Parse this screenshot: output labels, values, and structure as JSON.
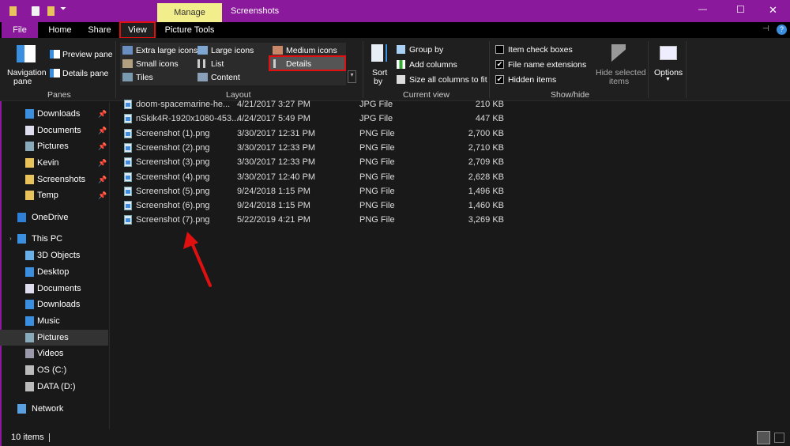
{
  "titlebar": {
    "context_tab": "Manage",
    "title": "Screenshots",
    "minimize": "—",
    "maximize": "☐",
    "close": "✕"
  },
  "tabs": [
    {
      "label": "File"
    },
    {
      "label": "Home"
    },
    {
      "label": "Share"
    },
    {
      "label": "View"
    },
    {
      "label": "Picture Tools"
    }
  ],
  "ribbon": {
    "panes": {
      "navigation_pane": "Navigation",
      "navigation_pane2": "pane",
      "preview_pane": "Preview pane",
      "details_pane": "Details pane",
      "group": "Panes"
    },
    "layout": {
      "items": [
        "Extra large icons",
        "Large icons",
        "Medium icons",
        "Small icons",
        "List",
        "Details",
        "Tiles",
        "Content"
      ],
      "selected": "Details",
      "group": "Layout"
    },
    "current_view": {
      "sort_by": "Sort",
      "sort_by2": "by",
      "group_by": "Group by",
      "add_columns": "Add columns",
      "size_all": "Size all columns to fit",
      "group": "Current view"
    },
    "show_hide": {
      "item_check_boxes": "Item check boxes",
      "item_check_boxes_checked": false,
      "file_name_extensions": "File name extensions",
      "file_name_extensions_checked": true,
      "hidden_items": "Hidden items",
      "hidden_items_checked": true,
      "hide_selected": "Hide selected",
      "hide_selected2": "items",
      "group": "Show/hide"
    },
    "options": "Options"
  },
  "sidebar": {
    "items": [
      {
        "label": "Downloads",
        "pinned": true,
        "icon": "download-icon"
      },
      {
        "label": "Documents",
        "pinned": true,
        "icon": "document-icon"
      },
      {
        "label": "Pictures",
        "pinned": true,
        "icon": "pictures-icon"
      },
      {
        "label": "Kevin",
        "pinned": true,
        "icon": "folder-icon"
      },
      {
        "label": "Screenshots",
        "pinned": true,
        "icon": "folder-icon"
      },
      {
        "label": "Temp",
        "pinned": true,
        "icon": "folder-icon"
      },
      {
        "label": "OneDrive",
        "icon": "cloud-icon"
      },
      {
        "label": "This PC",
        "icon": "computer-icon"
      },
      {
        "label": "3D Objects",
        "icon": "cube-icon"
      },
      {
        "label": "Desktop",
        "icon": "desktop-icon"
      },
      {
        "label": "Documents",
        "icon": "document-icon"
      },
      {
        "label": "Downloads",
        "icon": "download-icon"
      },
      {
        "label": "Music",
        "icon": "music-icon"
      },
      {
        "label": "Pictures",
        "icon": "pictures-icon",
        "selected": true
      },
      {
        "label": "Videos",
        "icon": "video-icon"
      },
      {
        "label": "OS (C:)",
        "icon": "drive-icon"
      },
      {
        "label": "DATA (D:)",
        "icon": "drive-icon"
      },
      {
        "label": "Network",
        "icon": "network-icon"
      }
    ],
    "pin_glyph": "📌"
  },
  "files": [
    {
      "name": "doom-spacemarine-he...",
      "date": "4/21/2017 3:27 PM",
      "type": "JPG File",
      "size": "210 KB"
    },
    {
      "name": "nSkik4R-1920x1080-453...",
      "date": "4/24/2017 5:49 PM",
      "type": "JPG File",
      "size": "447 KB"
    },
    {
      "name": "Screenshot (1).png",
      "date": "3/30/2017 12:31 PM",
      "type": "PNG File",
      "size": "2,700 KB"
    },
    {
      "name": "Screenshot (2).png",
      "date": "3/30/2017 12:33 PM",
      "type": "PNG File",
      "size": "2,710 KB"
    },
    {
      "name": "Screenshot (3).png",
      "date": "3/30/2017 12:33 PM",
      "type": "PNG File",
      "size": "2,709 KB"
    },
    {
      "name": "Screenshot (4).png",
      "date": "3/30/2017 12:40 PM",
      "type": "PNG File",
      "size": "2,628 KB"
    },
    {
      "name": "Screenshot (5).png",
      "date": "9/24/2018 1:15 PM",
      "type": "PNG File",
      "size": "1,496 KB"
    },
    {
      "name": "Screenshot (6).png",
      "date": "9/24/2018 1:15 PM",
      "type": "PNG File",
      "size": "1,460 KB"
    },
    {
      "name": "Screenshot (7).png",
      "date": "5/22/2019 4:21 PM",
      "type": "PNG File",
      "size": "3,269 KB"
    }
  ],
  "status": {
    "count": "10 items"
  },
  "colors": {
    "accent": "#8a1a9b",
    "highlight": "#e01010",
    "manage_tab": "#f3ee8c"
  }
}
